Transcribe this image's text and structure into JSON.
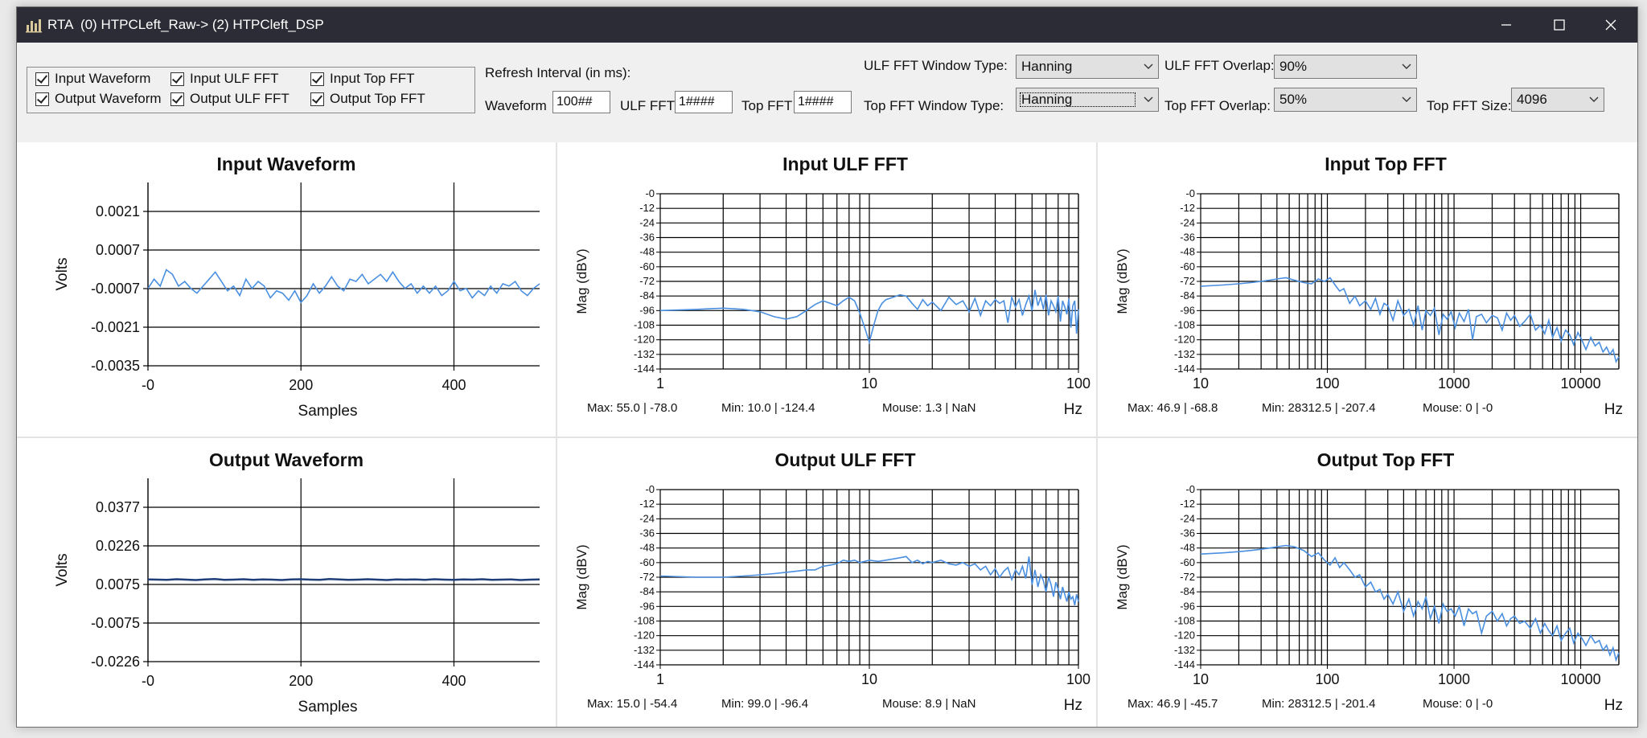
{
  "window": {
    "title": "RTA  (0) HTPCLeft_Raw-> (2) HTPCleft_DSP"
  },
  "controls": {
    "checkboxes": [
      {
        "id": "input-waveform",
        "label": "Input Waveform",
        "checked": true
      },
      {
        "id": "input-ulf-fft",
        "label": "Input ULF FFT",
        "checked": true
      },
      {
        "id": "input-top-fft",
        "label": "Input Top FFT",
        "checked": true
      },
      {
        "id": "output-waveform",
        "label": "Output Waveform",
        "checked": true
      },
      {
        "id": "output-ulf-fft",
        "label": "Output ULF FFT",
        "checked": true
      },
      {
        "id": "output-top-fft",
        "label": "Output Top FFT",
        "checked": true
      }
    ],
    "refresh_label": "Refresh Interval (in ms):",
    "waveform_label": "Waveform",
    "waveform_value": "100##",
    "ulf_fft_label": "ULF FFT",
    "ulf_fft_value": "1####",
    "top_fft_label": "Top FFT",
    "top_fft_value": "1####",
    "ulf_window_label": "ULF FFT Window Type:",
    "ulf_window_value": "Hanning",
    "top_window_label": "Top FFT Window Type:",
    "top_window_value": "Hanning",
    "ulf_overlap_label": "ULF FFT Overlap:",
    "ulf_overlap_value": "90%",
    "top_overlap_label": "Top FFT Overlap:",
    "top_overlap_value": "50%",
    "top_size_label": "Top FFT Size:",
    "top_size_value": "4096"
  },
  "colors": {
    "trace": "#4a8fe0",
    "trace_dark": "#1f3f7a",
    "grid": "#000000",
    "titlebar": "#2c2c36"
  },
  "chart_data": [
    {
      "id": "input-waveform",
      "type": "line",
      "title": "Input Waveform",
      "xlabel": "Samples",
      "ylabel": "Volts",
      "xlim": [
        0,
        512
      ],
      "ylim": [
        -0.0035,
        0.0035
      ],
      "x_ticks": [
        "-0",
        "200",
        "400"
      ],
      "y_ticks": [
        "0.0021",
        "0.0007",
        "-0.0007",
        "-0.0021",
        "-0.0035"
      ],
      "series": [
        {
          "values": [
            -0.0002,
            0.0002,
            -0.0001,
            0.0006,
            0.0004,
            -0.0001,
            0.0001,
            -0.0002,
            -0.0004,
            -0.0001,
            0.0002,
            0.0005,
            0.0001,
            -0.0003,
            -0.0001,
            -0.0005,
            0.0002,
            -0.0002,
            0.0001,
            -0.0001,
            -0.0006,
            -0.0003,
            -0.0004,
            -0.0007,
            -0.0003,
            -0.0008,
            -0.0005,
            0.0,
            -0.0004,
            -0.0001,
            0.0003,
            -0.0001,
            -0.0003,
            0.0002,
            0.0001,
            0.0004,
            0.0,
            0.0002,
            0.0004,
            0.0001,
            0.0005,
            0.0001,
            -0.0002,
            0.0,
            -0.0004,
            -0.0001,
            -0.0004,
            -0.0001,
            -0.0005,
            -0.0003,
            0.0001,
            -0.0003,
            -0.0002,
            -0.0006,
            -0.0003,
            -0.0005,
            -0.0001,
            -0.0004,
            0.0,
            -0.0001,
            0.0001,
            -0.0003,
            -0.0005,
            -0.0002,
            0.0
          ]
        }
      ]
    },
    {
      "id": "input-ulf-fft",
      "type": "line",
      "title": "Input ULF FFT",
      "xlabel": "Hz",
      "ylabel": "Mag (dBV)",
      "x_scale": "log",
      "xlim": [
        1,
        100
      ],
      "ylim": [
        -144,
        0
      ],
      "x_ticks": [
        "1",
        "10",
        "100"
      ],
      "y_ticks": [
        "-0",
        "-12",
        "-24",
        "-36",
        "-48",
        "-60",
        "-72",
        "-84",
        "-96",
        "-108",
        "-120",
        "-132",
        "-144"
      ],
      "stats": {
        "max": "Max: 55.0 | -78.0",
        "min": "Min: 10.0 | -124.4",
        "mouse": "Mouse: 1.3 | NaN"
      },
      "series": [
        {
          "x": [
            1,
            1.5,
            2,
            2.5,
            3,
            3.5,
            4,
            4.5,
            5,
            5.5,
            6,
            6.5,
            7,
            7.5,
            8,
            8.5,
            9,
            9.5,
            10,
            10.5,
            11,
            11.5,
            12,
            13,
            14,
            15,
            16,
            17,
            18,
            19,
            20,
            22,
            24,
            26,
            28,
            30,
            32,
            34,
            36,
            38,
            40,
            42,
            44,
            46,
            48,
            50,
            52,
            54,
            56,
            58,
            60,
            62,
            64,
            66,
            68,
            70,
            72,
            74,
            76,
            78,
            80,
            82,
            84,
            86,
            88,
            90,
            92,
            94,
            96,
            98,
            100
          ],
          "y": [
            -96,
            -95,
            -94,
            -95,
            -97,
            -101,
            -103,
            -101,
            -96,
            -91,
            -88,
            -90,
            -92,
            -88,
            -85,
            -88,
            -98,
            -110,
            -122,
            -108,
            -96,
            -90,
            -87,
            -85,
            -83,
            -84,
            -90,
            -95,
            -87,
            -92,
            -89,
            -96,
            -85,
            -91,
            -88,
            -97,
            -86,
            -100,
            -88,
            -92,
            -87,
            -90,
            -88,
            -106,
            -85,
            -93,
            -87,
            -100,
            -91,
            -84,
            -96,
            -79,
            -92,
            -85,
            -95,
            -83,
            -100,
            -88,
            -92,
            -97,
            -84,
            -105,
            -88,
            -93,
            -99,
            -86,
            -110,
            -92,
            -88,
            -115,
            -95
          ]
        }
      ]
    },
    {
      "id": "input-top-fft",
      "type": "line",
      "title": "Input Top FFT",
      "xlabel": "Hz",
      "ylabel": "Mag (dBV)",
      "x_scale": "log",
      "xlim": [
        10,
        20000
      ],
      "ylim": [
        -144,
        0
      ],
      "x_ticks": [
        "10",
        "100",
        "1000",
        "10000"
      ],
      "y_ticks": [
        "-0",
        "-12",
        "-24",
        "-36",
        "-48",
        "-60",
        "-72",
        "-84",
        "-96",
        "-108",
        "-120",
        "-132",
        "-144"
      ],
      "stats": {
        "max": "Max: 46.9 | -68.8",
        "min": "Min: 28312.5 | -207.4",
        "mouse": "Mouse: 0 | -0"
      },
      "series": [
        {
          "x": [
            10,
            15,
            20,
            25,
            30,
            35,
            40,
            47,
            55,
            65,
            75,
            85,
            95,
            105,
            115,
            125,
            135,
            150,
            165,
            180,
            200,
            220,
            240,
            260,
            280,
            300,
            330,
            360,
            400,
            440,
            480,
            520,
            560,
            600,
            650,
            700,
            760,
            820,
            880,
            950,
            1020,
            1100,
            1200,
            1300,
            1400,
            1500,
            1650,
            1800,
            2000,
            2200,
            2400,
            2600,
            2800,
            3000,
            3300,
            3600,
            4000,
            4400,
            4800,
            5200,
            5600,
            6000,
            6500,
            7000,
            7600,
            8200,
            8800,
            9500,
            10200,
            11000,
            12000,
            13000,
            14000,
            15000,
            16000,
            17000,
            18000,
            19000,
            20000
          ],
          "y": [
            -76,
            -75,
            -74,
            -73,
            -72,
            -71,
            -70,
            -69,
            -71,
            -73,
            -74,
            -70,
            -72,
            -69,
            -75,
            -80,
            -78,
            -90,
            -84,
            -92,
            -88,
            -95,
            -86,
            -99,
            -90,
            -92,
            -104,
            -88,
            -100,
            -95,
            -108,
            -92,
            -112,
            -96,
            -100,
            -94,
            -116,
            -99,
            -103,
            -97,
            -110,
            -98,
            -105,
            -95,
            -120,
            -101,
            -99,
            -106,
            -100,
            -102,
            -112,
            -98,
            -104,
            -100,
            -109,
            -105,
            -99,
            -112,
            -108,
            -115,
            -104,
            -118,
            -110,
            -121,
            -112,
            -116,
            -124,
            -114,
            -120,
            -128,
            -118,
            -125,
            -122,
            -130,
            -126,
            -132,
            -128,
            -138,
            -134
          ]
        }
      ]
    },
    {
      "id": "output-waveform",
      "type": "line",
      "title": "Output Waveform",
      "xlabel": "Samples",
      "ylabel": "Volts",
      "xlim": [
        0,
        512
      ],
      "ylim": [
        -0.0377,
        0.0377
      ],
      "x_ticks": [
        "-0",
        "200",
        "400"
      ],
      "y_ticks": [
        "0.0377",
        "0.0226",
        "0.0075",
        "-0.0075",
        "-0.0226"
      ],
      "series": [
        {
          "values": [
            0.0001,
            0.0,
            -0.0001,
            0.0002,
            0.0,
            -0.0002,
            0.0001,
            0.0003,
            -0.0001,
            0.0,
            0.0002,
            -0.0001,
            0.0001,
            0.0,
            -0.0002,
            0.0001,
            0.0002,
            0.0,
            -0.0001,
            0.0003,
            0.0001,
            -0.0001,
            0.0,
            0.0002,
            0.0,
            -0.0002,
            0.0001,
            0.0,
            0.0001,
            -0.0001,
            0.0002,
            0.0,
            -0.0001,
            0.0001,
            0.0,
            0.0002,
            -0.0001,
            0.0,
            0.0001,
            -0.0002,
            0.0,
            0.0001
          ]
        }
      ]
    },
    {
      "id": "output-ulf-fft",
      "type": "line",
      "title": "Output ULF FFT",
      "xlabel": "Hz",
      "ylabel": "Mag (dBV)",
      "x_scale": "log",
      "xlim": [
        1,
        100
      ],
      "ylim": [
        -144,
        0
      ],
      "x_ticks": [
        "1",
        "10",
        "100"
      ],
      "y_ticks": [
        "-0",
        "-12",
        "-24",
        "-36",
        "-48",
        "-60",
        "-72",
        "-84",
        "-96",
        "-108",
        "-120",
        "-132",
        "-144"
      ],
      "stats": {
        "max": "Max: 15.0 | -54.4",
        "min": "Min: 99.0 | -96.4",
        "mouse": "Mouse: 8.9 | NaN"
      },
      "series": [
        {
          "x": [
            1,
            1.5,
            2,
            2.5,
            3,
            3.5,
            4,
            4.5,
            5,
            5.5,
            6,
            6.5,
            7,
            7.5,
            8,
            8.5,
            9,
            9.5,
            10,
            11,
            12,
            13,
            14,
            15,
            16,
            17,
            18,
            19,
            20,
            22,
            24,
            26,
            28,
            30,
            32,
            34,
            36,
            38,
            40,
            42,
            44,
            46,
            48,
            50,
            52,
            54,
            56,
            58,
            60,
            62,
            64,
            66,
            68,
            70,
            72,
            74,
            76,
            78,
            80,
            82,
            84,
            86,
            88,
            90,
            92,
            94,
            96,
            98,
            100
          ],
          "y": [
            -71,
            -72,
            -72,
            -71,
            -70,
            -69,
            -68,
            -67,
            -66,
            -66,
            -63,
            -62,
            -61,
            -58,
            -59,
            -58,
            -60,
            -59,
            -58,
            -59,
            -58,
            -57,
            -56,
            -55,
            -60,
            -58,
            -61,
            -59,
            -60,
            -58,
            -61,
            -62,
            -60,
            -63,
            -61,
            -66,
            -63,
            -70,
            -65,
            -72,
            -67,
            -64,
            -74,
            -66,
            -70,
            -63,
            -73,
            -55,
            -78,
            -66,
            -80,
            -70,
            -75,
            -84,
            -72,
            -78,
            -88,
            -76,
            -82,
            -90,
            -80,
            -86,
            -92,
            -84,
            -90,
            -88,
            -95,
            -86,
            -92
          ]
        }
      ]
    },
    {
      "id": "output-top-fft",
      "type": "line",
      "title": "Output Top FFT",
      "xlabel": "Hz",
      "ylabel": "Mag (dBV)",
      "x_scale": "log",
      "xlim": [
        10,
        20000
      ],
      "ylim": [
        -144,
        0
      ],
      "x_ticks": [
        "10",
        "100",
        "1000",
        "10000"
      ],
      "y_ticks": [
        "-0",
        "-12",
        "-24",
        "-36",
        "-48",
        "-60",
        "-72",
        "-84",
        "-96",
        "-108",
        "-120",
        "-132",
        "-144"
      ],
      "stats": {
        "max": "Max: 46.9 | -45.7",
        "min": "Min: 28312.5 | -201.4",
        "mouse": "Mouse: 0 | -0"
      },
      "series": [
        {
          "x": [
            10,
            15,
            20,
            25,
            30,
            35,
            40,
            47,
            55,
            65,
            75,
            85,
            95,
            105,
            115,
            125,
            135,
            150,
            165,
            180,
            200,
            220,
            240,
            260,
            280,
            300,
            330,
            360,
            400,
            440,
            480,
            520,
            560,
            600,
            650,
            700,
            760,
            820,
            880,
            950,
            1020,
            1100,
            1200,
            1300,
            1400,
            1500,
            1650,
            1800,
            2000,
            2200,
            2400,
            2600,
            2800,
            3000,
            3300,
            3600,
            4000,
            4400,
            4800,
            5200,
            5600,
            6000,
            6500,
            7000,
            7600,
            8200,
            8800,
            9500,
            10200,
            11000,
            12000,
            13000,
            14000,
            15000,
            16000,
            17000,
            18000,
            19000,
            20000
          ],
          "y": [
            -53,
            -52,
            -51,
            -50,
            -49,
            -48,
            -47,
            -46,
            -47,
            -50,
            -55,
            -52,
            -58,
            -62,
            -56,
            -64,
            -60,
            -66,
            -72,
            -70,
            -80,
            -76,
            -84,
            -82,
            -90,
            -86,
            -94,
            -84,
            -100,
            -90,
            -104,
            -92,
            -98,
            -88,
            -106,
            -96,
            -110,
            -94,
            -100,
            -98,
            -104,
            -96,
            -112,
            -98,
            -102,
            -100,
            -118,
            -104,
            -100,
            -108,
            -102,
            -112,
            -106,
            -104,
            -110,
            -108,
            -114,
            -106,
            -118,
            -110,
            -116,
            -120,
            -112,
            -124,
            -118,
            -114,
            -126,
            -118,
            -122,
            -128,
            -120,
            -126,
            -124,
            -132,
            -128,
            -136,
            -130,
            -140,
            -134
          ]
        }
      ]
    }
  ]
}
